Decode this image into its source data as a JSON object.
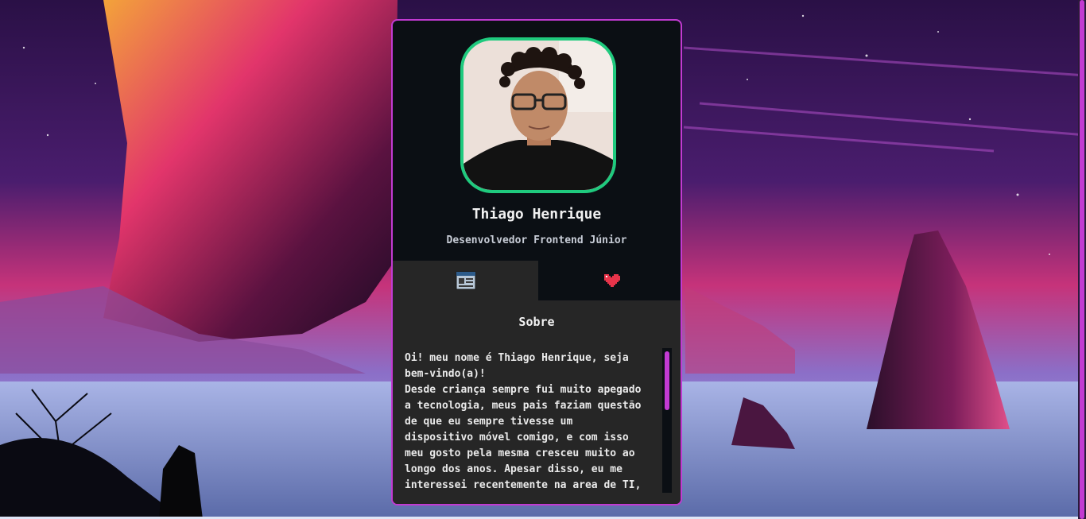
{
  "profile": {
    "name": "Thiago Henrique",
    "role": "Desenvolvedor Frontend Júnior",
    "avatar_alt": "profile photo"
  },
  "tabs": [
    {
      "icon": "profile-card-icon",
      "active": true
    },
    {
      "icon": "heart-icon",
      "active": false
    }
  ],
  "about": {
    "title": "Sobre",
    "text": "Oi! meu nome é Thiago Henrique, seja\nbem-vindo(a)!\nDesde criança sempre fui muito apegado\na tecnologia, meus pais faziam questão\nde que eu sempre tivesse um\ndispositivo móvel comigo, e com isso\nmeu gosto pela mesma cresceu muito ao\nlongo dos anos. Apesar disso, eu me\ninteressei recentemente na area de TI,"
  },
  "colors": {
    "accent": "#c23ad2",
    "avatar_border": "#1fca7e",
    "card_bg": "#0b0f14",
    "panel_bg": "#262626"
  }
}
